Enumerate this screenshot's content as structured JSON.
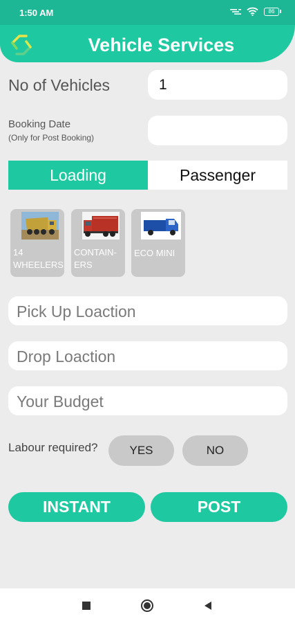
{
  "status_bar": {
    "time": "1:50 AM",
    "battery": "86",
    "icons": [
      "signal-icon",
      "wifi-icon",
      "battery-icon"
    ]
  },
  "header": {
    "title": "Vehicle Services",
    "icon": "refresh-icon"
  },
  "form": {
    "vehicles_label": "No of Vehicles",
    "vehicles_value": "1",
    "booking_date_label": "Booking Date",
    "booking_date_hint": "(Only for Post Booking)",
    "booking_date_value": ""
  },
  "toggle": {
    "loading": "Loading",
    "passenger": "Passenger",
    "active": "Loading"
  },
  "vehicles": [
    {
      "label": "14\nWHEELERS",
      "icon": "dump-truck-icon"
    },
    {
      "label": "CONTAIN-\nERS",
      "icon": "container-truck-icon"
    },
    {
      "label": "ECO MINI",
      "icon": "mini-truck-icon"
    }
  ],
  "inputs": {
    "pickup_placeholder": "Pick Up Loaction",
    "drop_placeholder": "Drop Loaction",
    "budget_placeholder": "Your Budget"
  },
  "labour": {
    "question": "Labour required?",
    "yes": "YES",
    "no": "NO"
  },
  "actions": {
    "instant": "INSTANT",
    "post": "POST"
  },
  "colors": {
    "accent": "#1ec9a1",
    "status_bar": "#1db795",
    "background": "#ececec",
    "chip": "#c9c9c9"
  },
  "nav": {
    "icons": [
      "recents-square-icon",
      "home-circle-icon",
      "back-triangle-icon"
    ]
  }
}
